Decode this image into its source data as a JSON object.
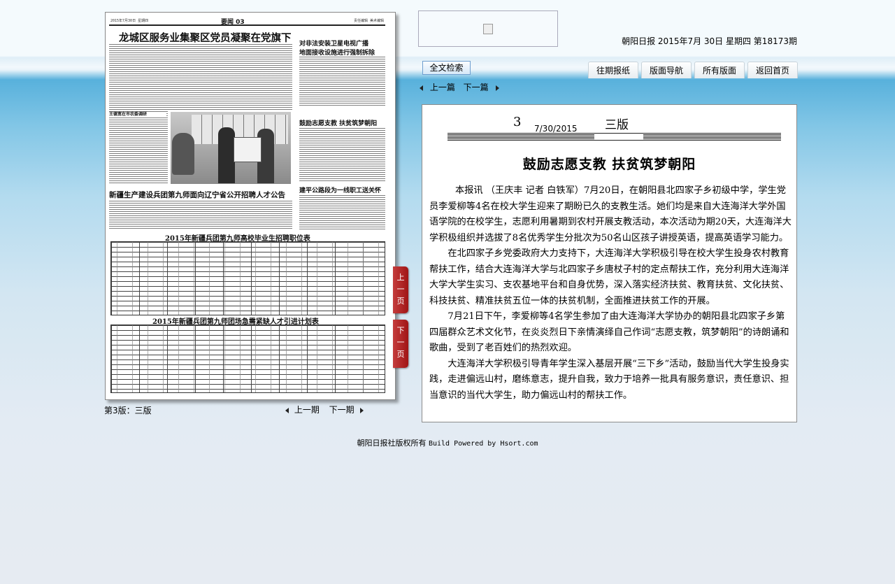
{
  "header": {
    "dateline": "朝阳日报  2015年7月  30日  星期四  第18173期",
    "search_label": "全文检索",
    "tabs": [
      "往期报纸",
      "版面导航",
      "所有版面",
      "返回首页"
    ]
  },
  "article_nav": {
    "prev": "上一篇",
    "next": "下一篇"
  },
  "paper_page": {
    "masthead": "要闻 03",
    "headlines": {
      "main": "龙城区服务业集聚区党员凝聚在党旗下",
      "side1a": "对非法安装卫星电视广播",
      "side1b": "地面接收设施进行强制拆除",
      "side2": "鼓励志愿支教  扶贫筑梦朝阳",
      "recruit": "新疆生产建设兵团第九师面向辽宁省公开招聘人才公告",
      "side3": "建平公路段为一线职工送关怀",
      "table1": "2015年新疆兵团第九师高校毕业生招聘职位表",
      "table2": "2015年新疆兵团第九师团场急需紧缺人才引进计划表"
    }
  },
  "flip": {
    "prev": [
      "上",
      "一",
      "页"
    ],
    "next": [
      "下",
      "一",
      "页"
    ]
  },
  "page_label": "第3版：三版",
  "issue_nav": {
    "prev": "上一期",
    "next": "下一期"
  },
  "article": {
    "page_number": "3",
    "date": "7/30/2015",
    "page_name": "三版",
    "title": "鼓励志愿支教  扶贫筑梦朝阳",
    "paragraphs": [
      "本报讯  （王庆丰  记者  白铁军）7月20日，在朝阳县北四家子乡初级中学，学生党员李爱柳等4名在校大学生迎来了期盼已久的支教生活。她们均是来自大连海洋大学外国语学院的在校学生，志愿利用暑期到农村开展支教活动，本次活动为期20天，大连海洋大学积极组织并选拔了8名优秀学生分批次为50名山区孩子讲授英语，提高英语学习能力。",
      "在北四家子乡党委政府大力支持下，大连海洋大学积极引导在校大学生投身农村教育帮扶工作，结合大连海洋大学与北四家子乡唐杖子村的定点帮扶工作，充分利用大连海洋大学大学生实习、支农基地平台和自身优势，深入落实经济扶贫、教育扶贫、文化扶贫、科技扶贫、精准扶贫五位一体的扶贫机制，全面推进扶贫工作的开展。",
      "7月21日下午，李爱柳等4名学生参加了由大连海洋大学协办的朝阳县北四家子乡第四届群众艺术文化节，在炎炎烈日下亲情演绎自己作词“志愿支教，筑梦朝阳”的诗朗诵和歌曲，受到了老百姓们的热烈欢迎。",
      "大连海洋大学积极引导青年学生深入基层开展“三下乡”活动，鼓励当代大学生投身实践，走进偏远山村，磨练意志，提升自我，致力于培养一批具有服务意识，责任意识、担当意识的当代大学生，助力偏远山村的帮扶工作。"
    ]
  },
  "footer": {
    "copyright": "朝阳日报社版权所有",
    "powered": "Build Powered by Hsort.com"
  }
}
